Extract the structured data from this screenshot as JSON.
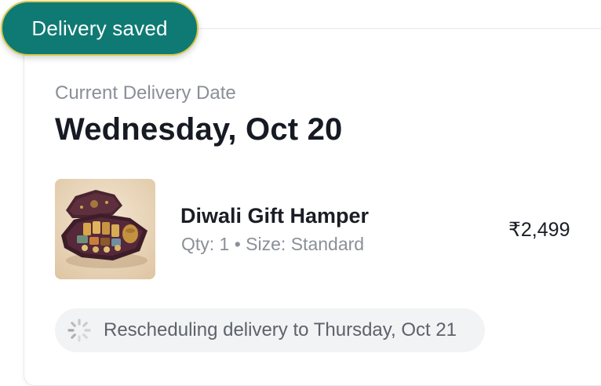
{
  "toast": {
    "text": "Delivery saved"
  },
  "delivery": {
    "label": "Current Delivery Date",
    "date": "Wednesday, Oct 20"
  },
  "item": {
    "name": "Diwali Gift Hamper",
    "meta": "Qty: 1 • Size: Standard",
    "price": "₹2,499"
  },
  "status": {
    "text": "Rescheduling delivery to Thursday, Oct 21",
    "icon": "loading-spinner-icon"
  },
  "colors": {
    "toast_bg": "#0f7a73",
    "toast_border": "#d6c94a",
    "card_border": "#e6e9ee",
    "status_bg": "#f2f3f4"
  }
}
